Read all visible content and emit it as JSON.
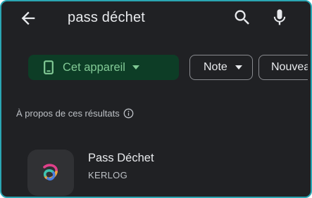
{
  "search": {
    "query": "pass déchet"
  },
  "icons": {
    "back": "arrow-back-icon",
    "search": "search-icon",
    "mic": "microphone-icon",
    "device": "phone-icon",
    "dropdown": "dropdown-caret-icon",
    "info": "info-icon",
    "app_logo": "pass-dechet-logo"
  },
  "filters": [
    {
      "label": "Cet appareil",
      "selected": true,
      "has_dropdown": true
    },
    {
      "label": "Note",
      "selected": false,
      "has_dropdown": true
    },
    {
      "label": "Nouveautés",
      "selected": false,
      "has_dropdown": false
    }
  ],
  "results_info": {
    "label": "À propos de ces résultats"
  },
  "results": [
    {
      "app_name": "Pass Déchet",
      "developer": "KERLOG"
    }
  ],
  "colors": {
    "background": "#202124",
    "selected_chip_bg": "#0d3d26",
    "selected_chip_text": "#81c995",
    "frame_border": "#2aa6b3"
  }
}
